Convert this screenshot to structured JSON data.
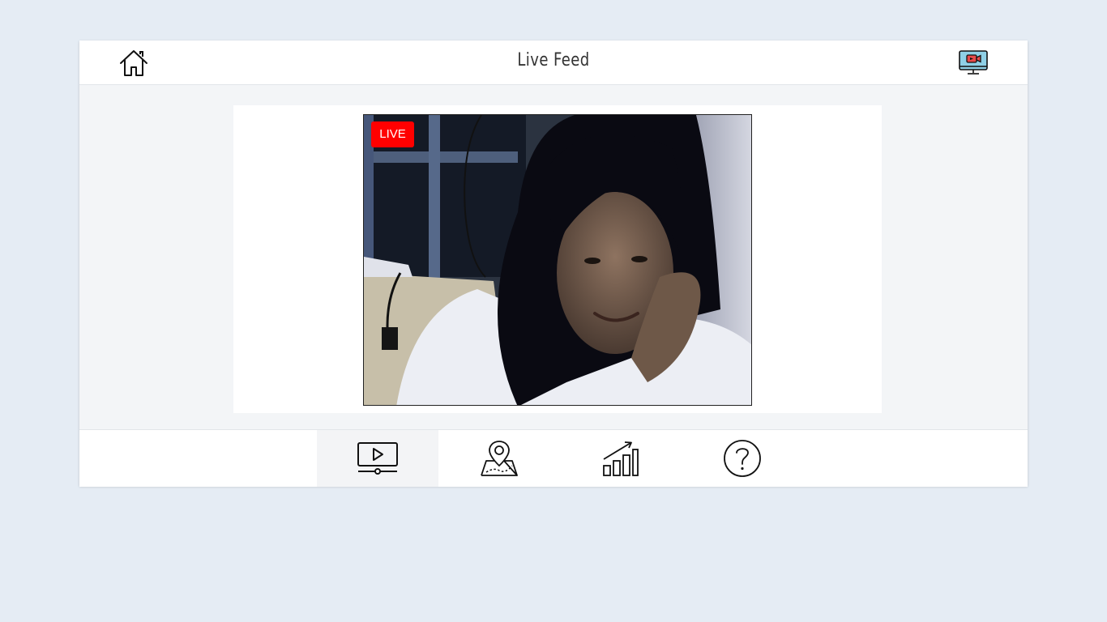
{
  "header": {
    "title": "Live Feed",
    "home_icon": "home-icon",
    "camera_icon": "monitor-camera-icon"
  },
  "video": {
    "badge": "LIVE",
    "badge_color": "#ff0000"
  },
  "nav": {
    "items": [
      {
        "icon": "video-player-icon",
        "active": true
      },
      {
        "icon": "map-location-icon",
        "active": false
      },
      {
        "icon": "growth-chart-icon",
        "active": false
      },
      {
        "icon": "help-icon",
        "active": false
      }
    ]
  }
}
